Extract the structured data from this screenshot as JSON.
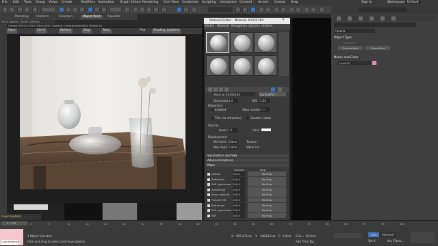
{
  "menubar": {
    "items": [
      "File",
      "Edit",
      "Tools",
      "Group",
      "Views",
      "Create",
      "Modifiers",
      "Animation",
      "Graph Editors",
      "Rendering",
      "Civil View",
      "Customize",
      "Scripting",
      "Interactive",
      "Content",
      "Arnold",
      "Corona",
      "Help"
    ],
    "sign_in": "Sign In",
    "workspaces_label": "Workspaces:",
    "workspace_value": "Default"
  },
  "ribbon": {
    "tabs": [
      "Modeling",
      "Freeform",
      "Selection",
      "Object Paint",
      "Populate"
    ],
    "sub": [
      "Paint Objects",
      "Brush Settings"
    ]
  },
  "viewport": {
    "title": "Corona VFB [1175x1175px] [0%] Camera: CoronaCamera002 [Frame 0]",
    "toolbar": [
      "Save",
      "Ctrl-C",
      "Refresh",
      "Stop",
      "Tools",
      "Pick",
      "Shading_Lightmix"
    ]
  },
  "material_editor": {
    "title": "Material Editor - Material #2455164",
    "menu": [
      "Modes",
      "Material",
      "Navigation",
      "Options",
      "Utilities"
    ],
    "material_name": "Material #2455164",
    "type": "CoronaPhy",
    "glossiness_label": "Glossiness:",
    "glossiness_value": "1,0",
    "ior_label": "IOR:",
    "ior_value": "1,52",
    "dispersion": "Dispersion",
    "enabled": "Enabled",
    "abbe_label": "Abbe number:",
    "abbe_value": "40,0",
    "thin": "Thin (no refraction)",
    "caustics": "Caustics (slow)",
    "opacity": "Opacity",
    "level_label": "Level:",
    "level_value": "1,0",
    "color_label": "Color:",
    "displacement": "Displacement",
    "min_level_label": "Min level:",
    "min_level_value": "0,0cm",
    "max_level_label": "Max level:",
    "max_level_value": "1,0cm",
    "texture_label": "Texture:",
    "water_label": "Water lvl:",
    "rollouts": [
      "Volumetrics and SSS",
      "Advanced options",
      "Maps"
    ],
    "maps_headers": [
      "Amount",
      "Map"
    ],
    "maps": [
      {
        "name": "Diffuse",
        "amount": "100,0",
        "map": "No Map"
      },
      {
        "name": "Reflection",
        "amount": "100,0",
        "map": "No Map"
      },
      {
        "name": "Refl. glossiness",
        "amount": "100,0",
        "map": "No Map"
      },
      {
        "name": "Anisotropy",
        "amount": "100,0",
        "map": "No Map"
      },
      {
        "name": "Aniso rotation",
        "amount": "100,0",
        "map": "No Map"
      },
      {
        "name": "Fresnel IOR",
        "amount": "100,0",
        "map": "No Map"
      },
      {
        "name": "Refraction",
        "amount": "100,0",
        "map": "No Map"
      },
      {
        "name": "Refr. glossiness",
        "amount": "100,0",
        "map": "No Map"
      },
      {
        "name": "IOR",
        "amount": "100,0",
        "map": "No Map"
      }
    ]
  },
  "command_panel": {
    "dropdown": "Corona",
    "object_type": "Object Type",
    "autogrid": "AutoGrid",
    "buttons": [
      "CoronaLight",
      "CoronaSun"
    ],
    "name_and_color": "Name and Color",
    "name_value": "Line012",
    "color_swatch": "#e58ab8"
  },
  "bottom": {
    "layer_explorer": "Layer Explorer",
    "frame": "0 / 100",
    "ticks": [
      "0",
      "5",
      "10",
      "15",
      "20",
      "25",
      "30",
      "35",
      "40",
      "45",
      "50",
      "55",
      "60",
      "65",
      "70",
      "75",
      "80",
      "85",
      "90",
      "95",
      "100"
    ],
    "selected": "1 Object Selected",
    "hint": "Click and drag to select and move objects",
    "maxscript": "CoronaMateria",
    "x_label": "X:",
    "x_value": "656,473cm",
    "y_label": "Y:",
    "y_value": "448,812cm",
    "z_label": "Z:",
    "z_value": "0,0cm",
    "grid": "Grid = 10,0cm",
    "add_time_tag": "Add Time Tag",
    "auto": "Auto",
    "set_key": "Set K.",
    "selected_dd": "Selected",
    "key_filters": "Key Filters..."
  }
}
